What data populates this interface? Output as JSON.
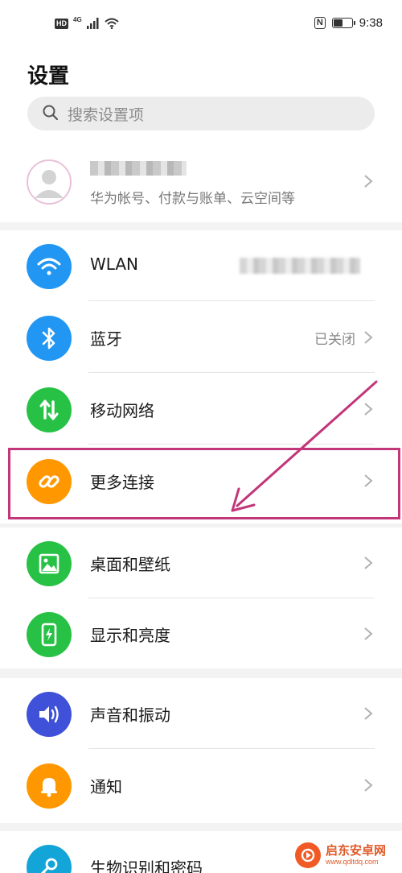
{
  "status_bar": {
    "hd_badge": "HD",
    "network_type": "4G",
    "nfc_badge": "N",
    "battery_level": 0.45,
    "time": "9:38"
  },
  "header": {
    "title": "设置",
    "search_placeholder": "搜索设置项"
  },
  "account": {
    "subtitle": "华为帐号、付款与账单、云空间等"
  },
  "groups": [
    {
      "items": [
        {
          "label": "WLAN",
          "icon": "wifi-icon",
          "color": "#2196f3"
        },
        {
          "label": "蓝牙",
          "value": "已关闭",
          "icon": "bluetooth-icon",
          "color": "#2196f3"
        },
        {
          "label": "移动网络",
          "icon": "mobile-data-icon",
          "color": "#27c245"
        },
        {
          "label": "更多连接",
          "icon": "link-icon",
          "color": "#ff9800"
        }
      ]
    },
    {
      "items": [
        {
          "label": "桌面和壁纸",
          "icon": "wallpaper-icon",
          "color": "#27c245"
        },
        {
          "label": "显示和亮度",
          "icon": "display-icon",
          "color": "#27c245"
        }
      ]
    },
    {
      "items": [
        {
          "label": "声音和振动",
          "icon": "sound-icon",
          "color": "#3f51d8"
        },
        {
          "label": "通知",
          "icon": "bell-icon",
          "color": "#ff9800"
        }
      ]
    },
    {
      "items": [
        {
          "label": "生物识别和密码",
          "icon": "key-icon",
          "color": "#13a4d8"
        }
      ]
    }
  ],
  "annotation": {
    "highlight_color": "#c2367a"
  },
  "watermark": {
    "title": "启东安卓网",
    "url": "www.qdltdq.com"
  }
}
